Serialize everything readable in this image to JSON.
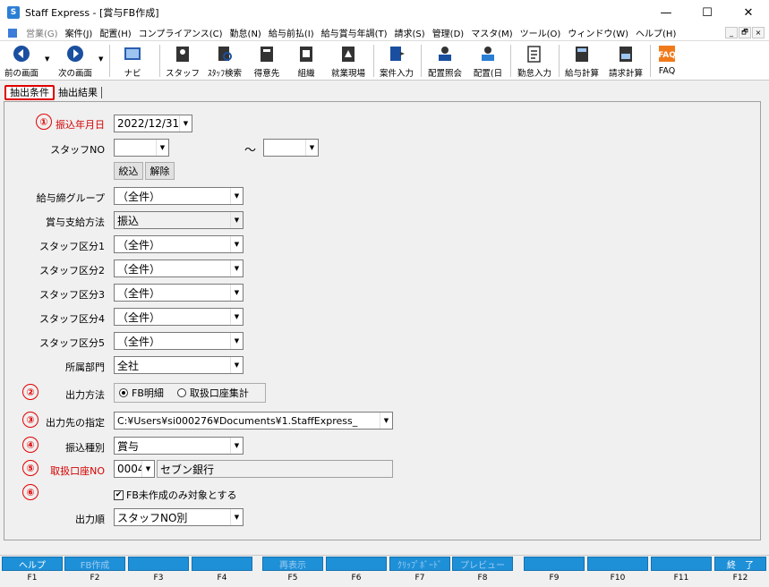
{
  "window": {
    "title": "Staff Express - [賞与FB作成]",
    "controls": {
      "minimize": "—",
      "maximize": "☐",
      "close": "✕"
    }
  },
  "menu": {
    "items": [
      "営業(G)",
      "案件(J)",
      "配置(H)",
      "コンプライアンス(C)",
      "勤怠(N)",
      "給与前払(I)",
      "給与賞与年調(T)",
      "請求(S)",
      "管理(D)",
      "マスタ(M)",
      "ツール(O)",
      "ウィンドウ(W)",
      "ヘルプ(H)"
    ],
    "mdi_controls": {
      "minimize": "_",
      "restore": "🗗",
      "close": "×"
    }
  },
  "toolbar": {
    "back": "前の画面",
    "forward": "次の画面",
    "navi": "ナビ",
    "staff": "スタッフ",
    "staff_search": "ｽﾀｯﾌ検索",
    "client": "得意先",
    "organization": "組織",
    "worksite": "就業現場",
    "case_entry": "案件入力",
    "assignment_inquiry": "配置照会",
    "assignment_day": "配置(日",
    "attendance_entry": "勤怠入力",
    "payroll_calc": "給与計算",
    "billing_calc": "請求計算",
    "faq": "FAQ"
  },
  "tabs": {
    "conditions": "抽出条件",
    "results": "抽出結果"
  },
  "markers": [
    "①",
    "②",
    "③",
    "④",
    "⑤",
    "⑥"
  ],
  "form": {
    "transfer_date": {
      "label": "振込年月日",
      "value": "2022/12/31"
    },
    "staff_no": {
      "label": "スタッフNO",
      "from": "",
      "to": "",
      "range_sep": "～"
    },
    "filter_button": "絞込",
    "clear_button": "解除",
    "payroll_group": {
      "label": "給与締グループ",
      "value": "（全件）"
    },
    "bonus_method": {
      "label": "賞与支給方法",
      "value": "振込"
    },
    "staff_cat1": {
      "label": "スタッフ区分1",
      "value": "（全件）"
    },
    "staff_cat2": {
      "label": "スタッフ区分2",
      "value": "（全件）"
    },
    "staff_cat3": {
      "label": "スタッフ区分3",
      "value": "（全件）"
    },
    "staff_cat4": {
      "label": "スタッフ区分4",
      "value": "（全件）"
    },
    "staff_cat5": {
      "label": "スタッフ区分5",
      "value": "（全件）"
    },
    "department": {
      "label": "所属部門",
      "value": "全社"
    },
    "output_method": {
      "label": "出力方法",
      "option1": "FB明細",
      "option2": "取扱口座集計",
      "selected": "FB明細"
    },
    "output_dest": {
      "label": "出力先の指定",
      "value": "C:¥Users¥si000276¥Documents¥1.StaffExpress_"
    },
    "transfer_type": {
      "label": "振込種別",
      "value": "賞与"
    },
    "bank_account": {
      "label": "取扱口座NO",
      "code": "0004",
      "bank_name": "セブン銀行"
    },
    "only_uncreated": {
      "label": "FB未作成のみ対象とする",
      "checked": true
    },
    "output_order": {
      "label": "出力順",
      "value": "スタッフNO別"
    }
  },
  "fkeys": [
    {
      "label": "ヘルプ",
      "code": "F1",
      "enabled": true
    },
    {
      "label": "FB作成",
      "code": "F2",
      "enabled": false
    },
    {
      "label": "",
      "code": "F3",
      "enabled": true
    },
    {
      "label": "",
      "code": "F4",
      "enabled": true
    },
    {
      "label": "再表示",
      "code": "F5",
      "enabled": false
    },
    {
      "label": "",
      "code": "F6",
      "enabled": true
    },
    {
      "label": "ｸﾘｯﾌﾟﾎﾞｰﾄﾞ",
      "code": "F7",
      "enabled": false
    },
    {
      "label": "プレビュー",
      "code": "F8",
      "enabled": false
    },
    {
      "label": "",
      "code": "F9",
      "enabled": true
    },
    {
      "label": "",
      "code": "F10",
      "enabled": true
    },
    {
      "label": "",
      "code": "F11",
      "enabled": true
    },
    {
      "label": "終　了",
      "code": "F12",
      "enabled": true
    }
  ],
  "colors": {
    "accent_red": "#e00000",
    "fkey_blue": "#1e90d8"
  }
}
